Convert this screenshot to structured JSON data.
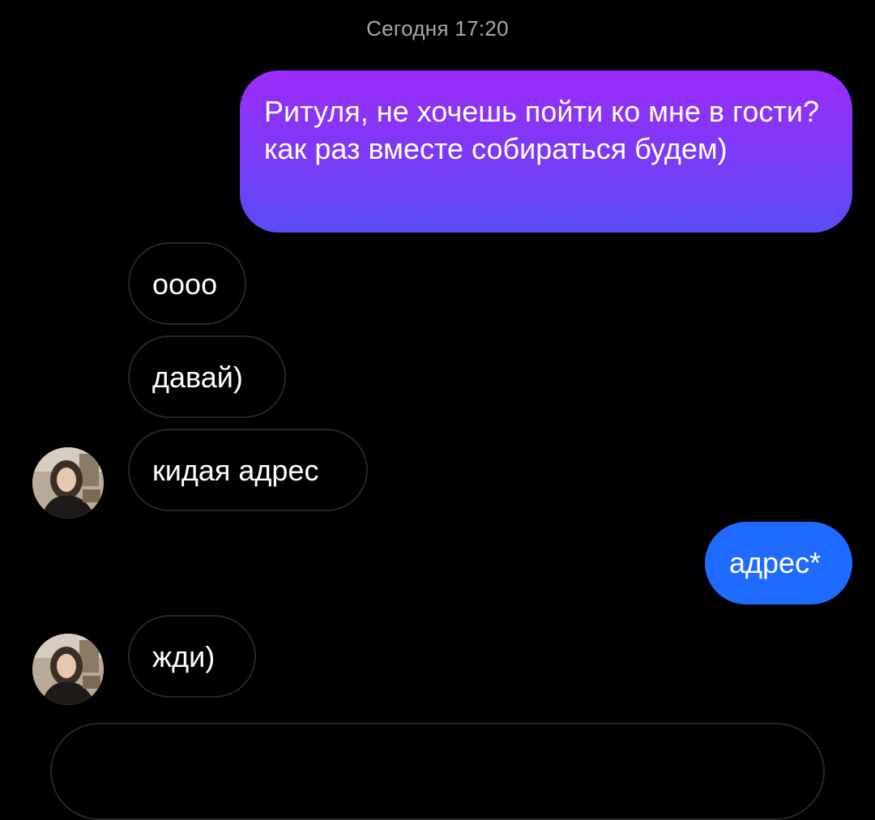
{
  "header": {
    "timestamp": "Сегодня 17:20"
  },
  "messages": [
    {
      "direction": "outgoing",
      "text": "Ритуля, не хочешь пойти ко мне в гости? как раз вместе собираться будем)"
    },
    {
      "direction": "incoming",
      "text": "оооо"
    },
    {
      "direction": "incoming",
      "text": "давай)"
    },
    {
      "direction": "incoming",
      "text": "кидая адрес",
      "avatar": "contact-avatar"
    },
    {
      "direction": "outgoing",
      "text": "адрес*"
    },
    {
      "direction": "incoming",
      "text": "жди)",
      "avatar": "contact-avatar"
    }
  ],
  "theme": {
    "background": "#000000",
    "outgoing_gradient": [
      "#9b2cfa",
      "#5b4cf6"
    ],
    "outgoing_blue": "#1f6bff",
    "incoming_border": "#262626",
    "timestamp_color": "#a8a8a8"
  }
}
